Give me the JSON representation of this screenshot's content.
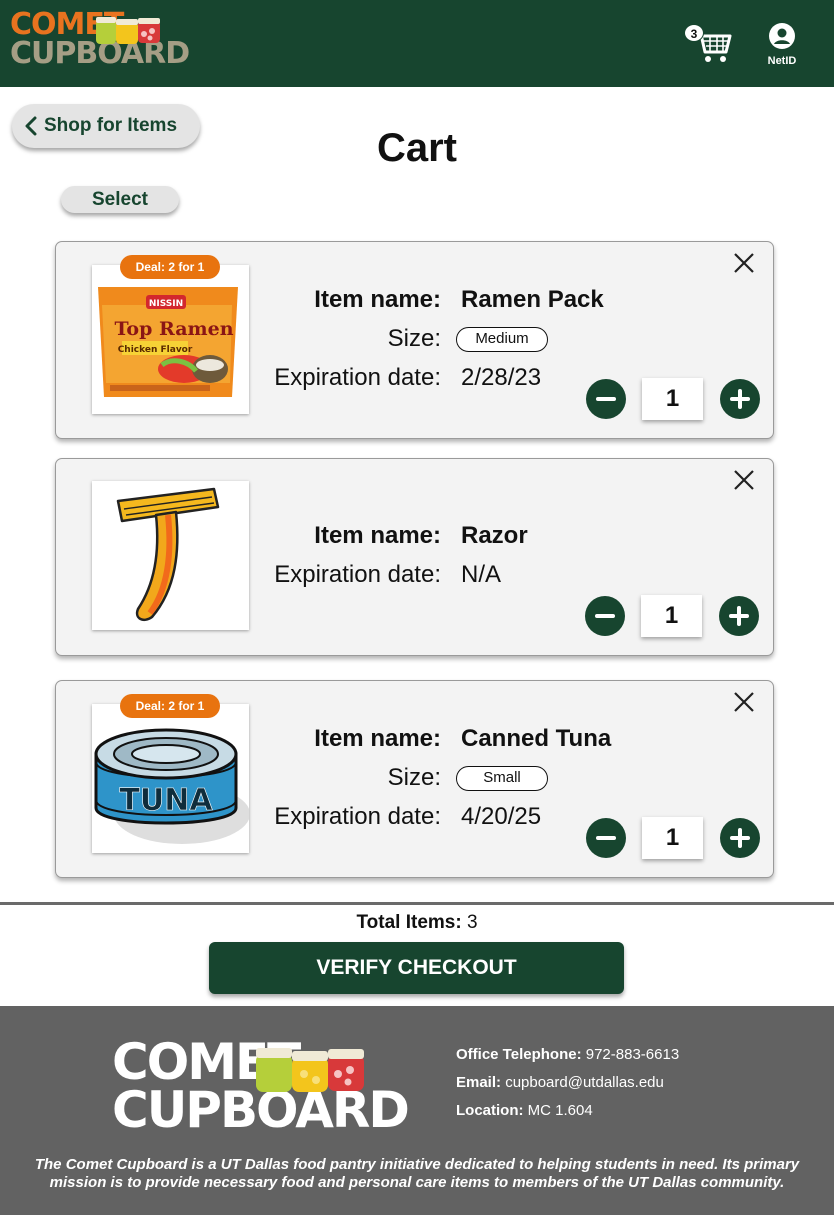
{
  "header": {
    "logo_line1": "COMET",
    "logo_line2": "CUPBOARD",
    "cart_count": "3",
    "account_label": "NetID"
  },
  "nav": {
    "back_label": "Shop for Items",
    "page_title": "Cart",
    "select_label": "Select"
  },
  "labels": {
    "item_name": "Item name:",
    "size": "Size:",
    "expiration": "Expiration date:"
  },
  "cart_items": [
    {
      "deal": "Deal: 2 for 1",
      "name": "Ramen Pack",
      "size": "Medium",
      "expiration": "2/28/23",
      "quantity": "1",
      "image_icon": "ramen-pack-image"
    },
    {
      "deal": "",
      "name": "Razor",
      "size": "",
      "expiration": "N/A",
      "quantity": "1",
      "image_icon": "razor-image"
    },
    {
      "deal": "Deal: 2 for 1",
      "name": "Canned Tuna",
      "size": "Small",
      "expiration": "4/20/25",
      "quantity": "1",
      "image_icon": "tuna-can-image"
    }
  ],
  "summary": {
    "total_label": "Total Items:",
    "total_value": "3",
    "checkout_label": "VERIFY CHECKOUT"
  },
  "footer": {
    "logo_line1": "COMET",
    "logo_line2": "CUPBOARD",
    "phone_label": "Office Telephone:",
    "phone_value": "972-883-6613",
    "email_label": "Email:",
    "email_value": "cupboard@utdallas.edu",
    "location_label": "Location:",
    "location_value": "MC 1.604",
    "mission": "The Comet Cupboard is a UT Dallas food pantry initiative dedicated to helping students in need. Its primary mission is to provide necessary food and personal care items to members of the UT Dallas community."
  },
  "colors": {
    "brand_green": "#17452f",
    "deal_orange": "#e8730f",
    "footer_gray": "#626262"
  }
}
